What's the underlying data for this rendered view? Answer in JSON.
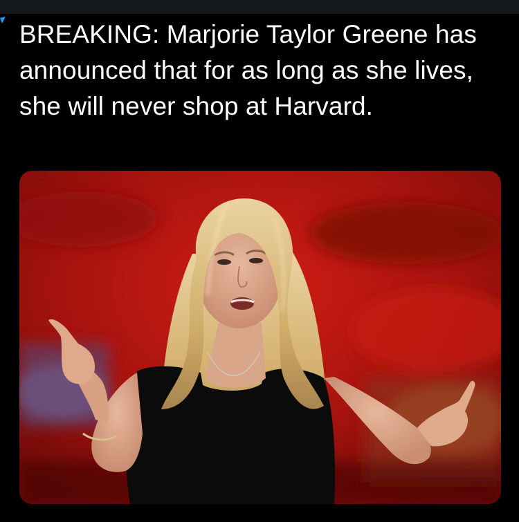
{
  "post": {
    "text": "BREAKING: Marjorie Taylor Greene has announced that for as long as she lives, she will never shop at Harvard."
  },
  "photo": {
    "subject": "woman-with-blonde-hair-pointing-both-hands",
    "backdrop_color": "#b3140f",
    "dress_color": "#0a0a0a",
    "hair_color": "#d9b774"
  },
  "colors": {
    "background": "#000000",
    "text": "#ffffff",
    "top_strip": "#15181c",
    "edge_accent": "#1d9bf0"
  }
}
